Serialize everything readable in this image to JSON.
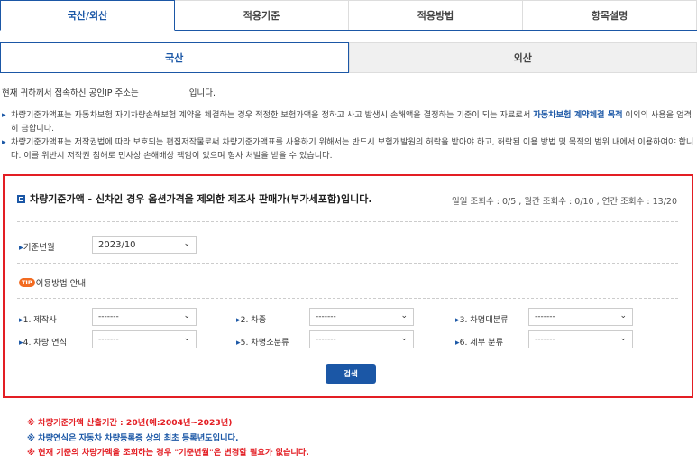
{
  "top_tabs": [
    "국산/외산",
    "적용기준",
    "적용방법",
    "항목설명"
  ],
  "sub_tabs": [
    "국산",
    "외산"
  ],
  "ip_text_before": "현재 귀하께서 접속하신 공인IP 주소는",
  "ip_text_after": "입니다.",
  "notices": {
    "n1_pre": "차량기준가액표는 자동차보험 자기차량손해보험 계약을 체결하는 경우 적정한 보험가액을 정하고 사고 발생시 손해액을 결정하는 기준이 되는 자료로서 ",
    "n1_hl": "자동차보험 계약체결 목적",
    "n1_post": " 이외의 사용을 엄격히 금합니다.",
    "n2": "차량기준가액표는 저작권법에 따라 보호되는 편집저작물로써 차량기준가액표를 사용하기 위해서는 반드시 보험개발원의 허락을 받아야 하고, 허락된 이용 방법 및 목적의 범위 내에서 이용하여야 합니다. 이를 위반시 저작권 침해로 민사상 손해배상 책임이 있으며 형사 처벌을 받을 수 있습니다."
  },
  "search": {
    "title": "차량기준가액 - 신차인 경우 옵션가격을 제외한 제조사 판매가(부가세포함)입니다.",
    "counts": "일일 조회수 : 0/5 , 월간 조회수 : 0/10 , 연간 조회수 : 13/20",
    "period_label": "기준년월",
    "period_value": "2023/10",
    "tip_badge": "TIP",
    "tip_label": "이용방법 안내",
    "fields": [
      {
        "label": "1. 제작사",
        "value": "-------"
      },
      {
        "label": "2. 차종",
        "value": "-------"
      },
      {
        "label": "3. 차명대분류",
        "value": "-------"
      },
      {
        "label": "4. 차량 연식",
        "value": "-------"
      },
      {
        "label": "5. 차명소분류",
        "value": "-------"
      },
      {
        "label": "6. 세부 분류",
        "value": "-------"
      }
    ],
    "button": "검색"
  },
  "footnotes": [
    "※ 차량기준가액 산출기간 : 20년(예:2004년~2023년)",
    "※ 차량연식은 자동차 차량등록증 상의 최초 등록년도입니다.",
    "※ 현재 기준의 차량가액을 조회하는 경우 \"기준년월\"은 변경할 필요가 없습니다."
  ]
}
